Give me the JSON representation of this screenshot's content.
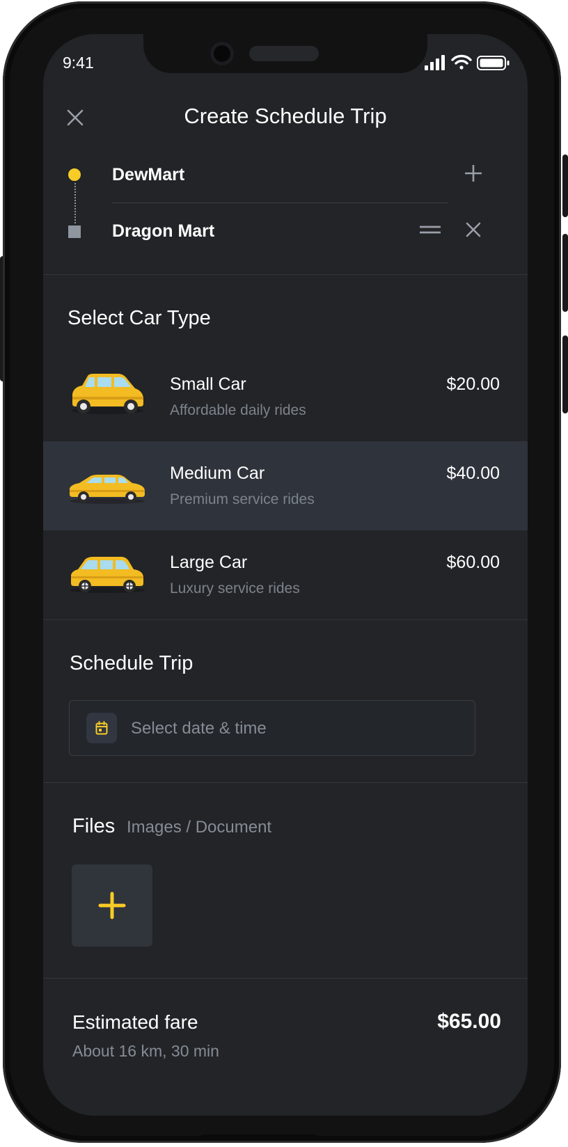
{
  "status_bar": {
    "time": "9:41"
  },
  "header": {
    "title": "Create Schedule Trip"
  },
  "route": {
    "pickup": "DewMart",
    "dropoff": "Dragon Mart"
  },
  "car_section": {
    "title": "Select Car Type",
    "cars": [
      {
        "name": "Small Car",
        "description": "Affordable daily rides",
        "price": "$20.00",
        "selected": false,
        "icon": "small-car-icon"
      },
      {
        "name": "Medium Car",
        "description": "Premium service rides",
        "price": "$40.00",
        "selected": true,
        "icon": "medium-car-icon"
      },
      {
        "name": "Large Car",
        "description": "Luxury service rides",
        "price": "$60.00",
        "selected": false,
        "icon": "large-car-icon"
      }
    ]
  },
  "schedule": {
    "title": "Schedule Trip",
    "placeholder": "Select date & time"
  },
  "files": {
    "title": "Files",
    "subtitle": "Images / Document"
  },
  "fare": {
    "label": "Estimated fare",
    "amount": "$65.00",
    "meta": "About 16 km, 30 min"
  },
  "colors": {
    "accent": "#f8cc26",
    "background": "#222427",
    "selected_row": "#2f333b",
    "muted_text": "#7d838d"
  }
}
